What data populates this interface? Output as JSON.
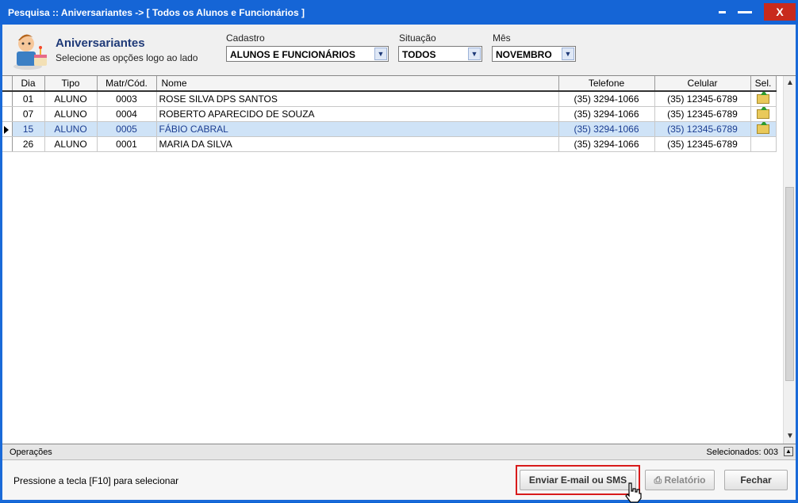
{
  "window": {
    "title": "Pesquisa :: Aniversariantes -> [ Todos os Alunos e Funcionários ]",
    "close_label": "X"
  },
  "header": {
    "title": "Aniversariantes",
    "subtitle": "Selecione as opções logo ao lado",
    "filters": {
      "cadastro": {
        "label": "Cadastro",
        "value": "ALUNOS E FUNCIONÁRIOS"
      },
      "situacao": {
        "label": "Situação",
        "value": "TODOS"
      },
      "mes": {
        "label": "Mês",
        "value": "NOVEMBRO"
      }
    }
  },
  "grid": {
    "columns": [
      "Dia",
      "Tipo",
      "Matr/Cód.",
      "Nome",
      "Telefone",
      "Celular",
      "Sel."
    ],
    "rows": [
      {
        "dia": "01",
        "tipo": "ALUNO",
        "matr": "0003",
        "nome": "ROSE SILVA DPS SANTOS",
        "telefone": "(35) 3294-1066",
        "celular": "(35) 12345-6789",
        "selected": true
      },
      {
        "dia": "07",
        "tipo": "ALUNO",
        "matr": "0004",
        "nome": "ROBERTO APARECIDO DE SOUZA",
        "telefone": "(35) 3294-1066",
        "celular": "(35) 12345-6789",
        "selected": true
      },
      {
        "dia": "15",
        "tipo": "ALUNO",
        "matr": "0005",
        "nome": "FÁBIO CABRAL",
        "telefone": "(35) 3294-1066",
        "celular": "(35) 12345-6789",
        "selected": true
      },
      {
        "dia": "26",
        "tipo": "ALUNO",
        "matr": "0001",
        "nome": "MARIA DA SILVA",
        "telefone": "(35) 3294-1066",
        "celular": "(35) 12345-6789",
        "selected": false
      }
    ],
    "current_row": 2
  },
  "operations": {
    "label": "Operações",
    "selected_count": "Selecionados: 003"
  },
  "footer": {
    "hint": "Pressione a tecla [F10] para selecionar",
    "send_button": "Enviar E-mail ou SMS",
    "report_button": "Relatório",
    "close_button": "Fechar"
  },
  "colors": {
    "titlebar": "#1565d6",
    "close": "#c82a1d",
    "selected_row": "#cfe3f7",
    "highlight": "#d81b1b"
  }
}
